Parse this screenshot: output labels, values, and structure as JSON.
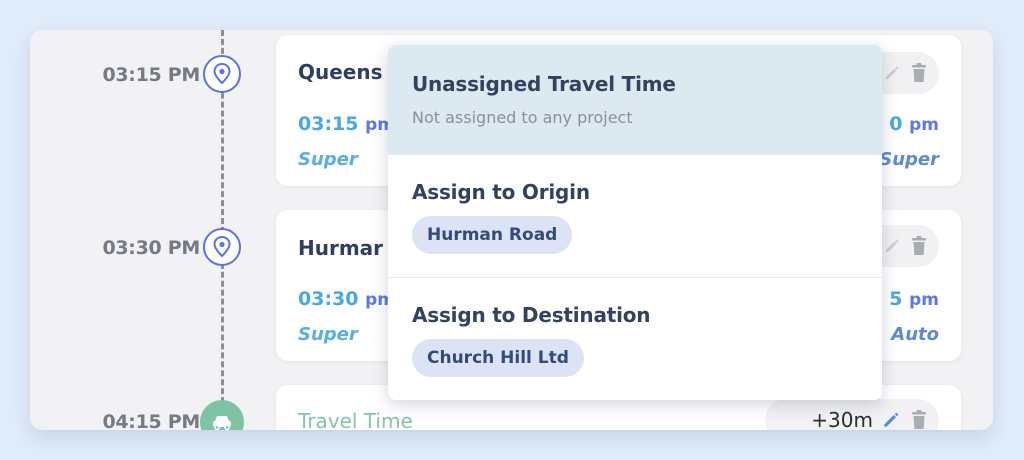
{
  "timeline": {
    "entries": [
      {
        "time": "03:15 PM",
        "icon": "location-pin-icon",
        "title": "Queens",
        "start_time": "03:15",
        "start_ampm": "pm",
        "end_time": "0",
        "end_ampm": "pm",
        "left_tag": "Super",
        "right_tag": "Super"
      },
      {
        "time": "03:30 PM",
        "icon": "location-pin-icon",
        "title": "Hurmar",
        "start_time": "03:30",
        "start_ampm": "pm",
        "end_time": "5",
        "end_ampm": "pm",
        "left_tag": "Super",
        "right_tag": "Auto"
      },
      {
        "time": "04:15 PM",
        "icon": "car-icon",
        "title": "Travel Time",
        "duration": "+30m"
      }
    ]
  },
  "dropdown": {
    "options": [
      {
        "title": "Unassigned Travel Time",
        "subtitle": "Not assigned to any project",
        "selected": true
      },
      {
        "title": "Assign to Origin",
        "chip": "Hurman Road"
      },
      {
        "title": "Assign to Destination",
        "chip": "Church Hill Ltd"
      }
    ]
  },
  "colors": {
    "accent_blue": "#5a72e6",
    "time_blue": "#47a8e6",
    "travel_green": "#7ec3a4",
    "selected_bg": "#dde9f0",
    "chip_bg": "#dbe3f4",
    "page_bg": "#e1edfb"
  }
}
